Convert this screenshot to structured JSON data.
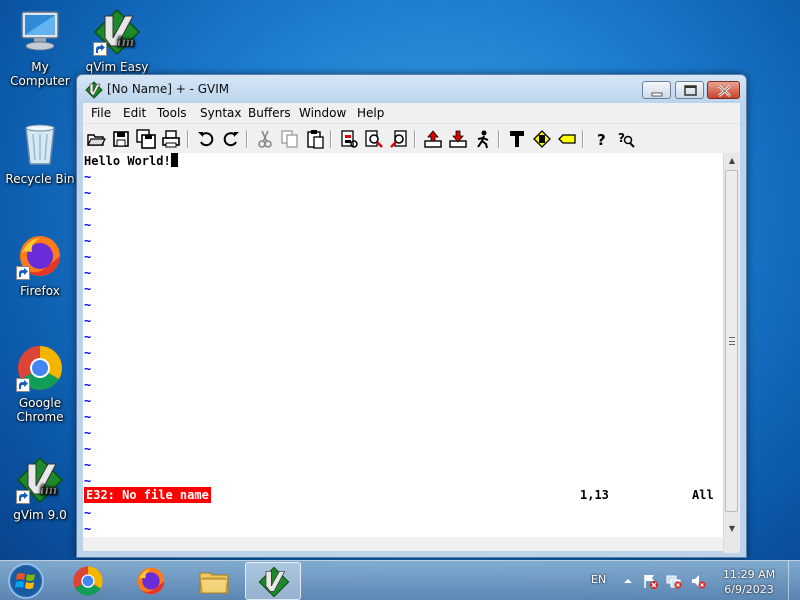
{
  "desktop": {
    "icons": [
      {
        "label": "My Computer",
        "icon": "computer-icon"
      },
      {
        "label": "qVim Easy 9.0",
        "icon": "vim-icon"
      },
      {
        "label": "Recycle Bin",
        "icon": "recycle-bin-icon"
      },
      {
        "label": "Firefox",
        "icon": "firefox-icon"
      },
      {
        "label": "Google Chrome",
        "icon": "chrome-icon"
      },
      {
        "label": "gVim 9.0",
        "icon": "vim-icon"
      }
    ]
  },
  "window": {
    "title": "[No Name] + - GVIM",
    "menu": [
      "File",
      "Edit",
      "Tools",
      "Syntax",
      "Buffers",
      "Window",
      "Help"
    ],
    "toolbar_icons": [
      "open-icon",
      "save-icon",
      "save-all-icon",
      "print-icon",
      "undo-icon",
      "redo-icon",
      "cut-icon",
      "copy-icon",
      "paste-icon",
      "find-replace-icon",
      "find-next-icon",
      "find-prev-icon",
      "load-session-icon",
      "save-session-icon",
      "run-script-icon",
      "make-icon",
      "shell-icon",
      "tags-icon",
      "help-icon",
      "find-help-icon"
    ]
  },
  "editor": {
    "text": "Hello World!",
    "tilde": "~",
    "error_message": "E32: No file name",
    "ruler": "1,13",
    "position": "All",
    "tilde_color": "#0000ff",
    "error_bg": "#ff0000"
  },
  "taskbar": {
    "language": "EN",
    "time": "11:29 AM",
    "date": "6/9/2023"
  }
}
